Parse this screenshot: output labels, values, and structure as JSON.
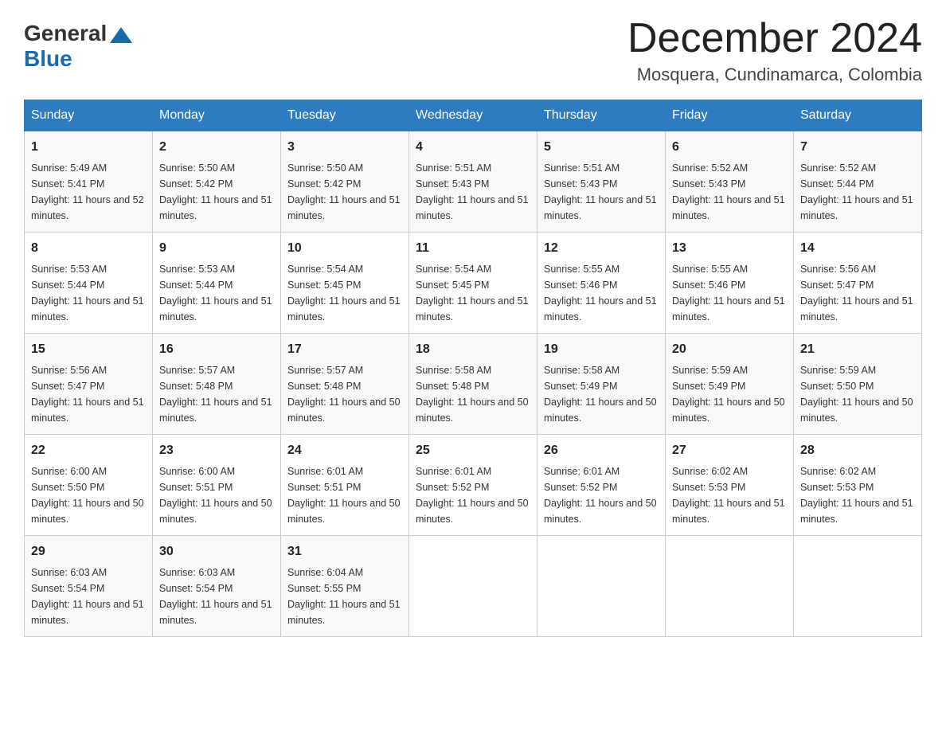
{
  "header": {
    "logo_general": "General",
    "logo_blue": "Blue",
    "month_title": "December 2024",
    "location": "Mosquera, Cundinamarca, Colombia"
  },
  "days_of_week": [
    "Sunday",
    "Monday",
    "Tuesday",
    "Wednesday",
    "Thursday",
    "Friday",
    "Saturday"
  ],
  "weeks": [
    [
      {
        "day": "1",
        "sunrise": "5:49 AM",
        "sunset": "5:41 PM",
        "daylight": "11 hours and 52 minutes."
      },
      {
        "day": "2",
        "sunrise": "5:50 AM",
        "sunset": "5:42 PM",
        "daylight": "11 hours and 51 minutes."
      },
      {
        "day": "3",
        "sunrise": "5:50 AM",
        "sunset": "5:42 PM",
        "daylight": "11 hours and 51 minutes."
      },
      {
        "day": "4",
        "sunrise": "5:51 AM",
        "sunset": "5:43 PM",
        "daylight": "11 hours and 51 minutes."
      },
      {
        "day": "5",
        "sunrise": "5:51 AM",
        "sunset": "5:43 PM",
        "daylight": "11 hours and 51 minutes."
      },
      {
        "day": "6",
        "sunrise": "5:52 AM",
        "sunset": "5:43 PM",
        "daylight": "11 hours and 51 minutes."
      },
      {
        "day": "7",
        "sunrise": "5:52 AM",
        "sunset": "5:44 PM",
        "daylight": "11 hours and 51 minutes."
      }
    ],
    [
      {
        "day": "8",
        "sunrise": "5:53 AM",
        "sunset": "5:44 PM",
        "daylight": "11 hours and 51 minutes."
      },
      {
        "day": "9",
        "sunrise": "5:53 AM",
        "sunset": "5:44 PM",
        "daylight": "11 hours and 51 minutes."
      },
      {
        "day": "10",
        "sunrise": "5:54 AM",
        "sunset": "5:45 PM",
        "daylight": "11 hours and 51 minutes."
      },
      {
        "day": "11",
        "sunrise": "5:54 AM",
        "sunset": "5:45 PM",
        "daylight": "11 hours and 51 minutes."
      },
      {
        "day": "12",
        "sunrise": "5:55 AM",
        "sunset": "5:46 PM",
        "daylight": "11 hours and 51 minutes."
      },
      {
        "day": "13",
        "sunrise": "5:55 AM",
        "sunset": "5:46 PM",
        "daylight": "11 hours and 51 minutes."
      },
      {
        "day": "14",
        "sunrise": "5:56 AM",
        "sunset": "5:47 PM",
        "daylight": "11 hours and 51 minutes."
      }
    ],
    [
      {
        "day": "15",
        "sunrise": "5:56 AM",
        "sunset": "5:47 PM",
        "daylight": "11 hours and 51 minutes."
      },
      {
        "day": "16",
        "sunrise": "5:57 AM",
        "sunset": "5:48 PM",
        "daylight": "11 hours and 51 minutes."
      },
      {
        "day": "17",
        "sunrise": "5:57 AM",
        "sunset": "5:48 PM",
        "daylight": "11 hours and 50 minutes."
      },
      {
        "day": "18",
        "sunrise": "5:58 AM",
        "sunset": "5:48 PM",
        "daylight": "11 hours and 50 minutes."
      },
      {
        "day": "19",
        "sunrise": "5:58 AM",
        "sunset": "5:49 PM",
        "daylight": "11 hours and 50 minutes."
      },
      {
        "day": "20",
        "sunrise": "5:59 AM",
        "sunset": "5:49 PM",
        "daylight": "11 hours and 50 minutes."
      },
      {
        "day": "21",
        "sunrise": "5:59 AM",
        "sunset": "5:50 PM",
        "daylight": "11 hours and 50 minutes."
      }
    ],
    [
      {
        "day": "22",
        "sunrise": "6:00 AM",
        "sunset": "5:50 PM",
        "daylight": "11 hours and 50 minutes."
      },
      {
        "day": "23",
        "sunrise": "6:00 AM",
        "sunset": "5:51 PM",
        "daylight": "11 hours and 50 minutes."
      },
      {
        "day": "24",
        "sunrise": "6:01 AM",
        "sunset": "5:51 PM",
        "daylight": "11 hours and 50 minutes."
      },
      {
        "day": "25",
        "sunrise": "6:01 AM",
        "sunset": "5:52 PM",
        "daylight": "11 hours and 50 minutes."
      },
      {
        "day": "26",
        "sunrise": "6:01 AM",
        "sunset": "5:52 PM",
        "daylight": "11 hours and 50 minutes."
      },
      {
        "day": "27",
        "sunrise": "6:02 AM",
        "sunset": "5:53 PM",
        "daylight": "11 hours and 51 minutes."
      },
      {
        "day": "28",
        "sunrise": "6:02 AM",
        "sunset": "5:53 PM",
        "daylight": "11 hours and 51 minutes."
      }
    ],
    [
      {
        "day": "29",
        "sunrise": "6:03 AM",
        "sunset": "5:54 PM",
        "daylight": "11 hours and 51 minutes."
      },
      {
        "day": "30",
        "sunrise": "6:03 AM",
        "sunset": "5:54 PM",
        "daylight": "11 hours and 51 minutes."
      },
      {
        "day": "31",
        "sunrise": "6:04 AM",
        "sunset": "5:55 PM",
        "daylight": "11 hours and 51 minutes."
      },
      null,
      null,
      null,
      null
    ]
  ]
}
